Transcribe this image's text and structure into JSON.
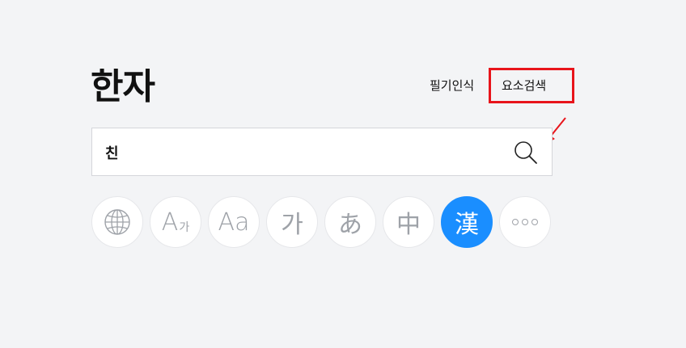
{
  "header": {
    "title": "한자",
    "nav": {
      "handwriting": "필기인식",
      "radical_search": "요소검색"
    }
  },
  "search": {
    "value": "친",
    "placeholder": ""
  },
  "language_buttons": [
    {
      "icon": "globe-icon",
      "label": "",
      "active": false
    },
    {
      "icon": "font-korean-icon",
      "label": "A",
      "sub": "가",
      "active": false
    },
    {
      "icon": "font-case-icon",
      "label": "Aa",
      "active": false
    },
    {
      "icon": "korean-icon",
      "label": "가",
      "active": false
    },
    {
      "icon": "japanese-icon",
      "label": "あ",
      "active": false
    },
    {
      "icon": "chinese-icon",
      "label": "中",
      "active": false
    },
    {
      "icon": "hanja-icon",
      "label": "漢",
      "active": true
    },
    {
      "icon": "more-icon",
      "label": "",
      "active": false
    }
  ],
  "colors": {
    "background": "#f3f4f6",
    "accent": "#1a8eff",
    "annotation": "#e8141b",
    "icon_gray": "#9ea2a8"
  }
}
